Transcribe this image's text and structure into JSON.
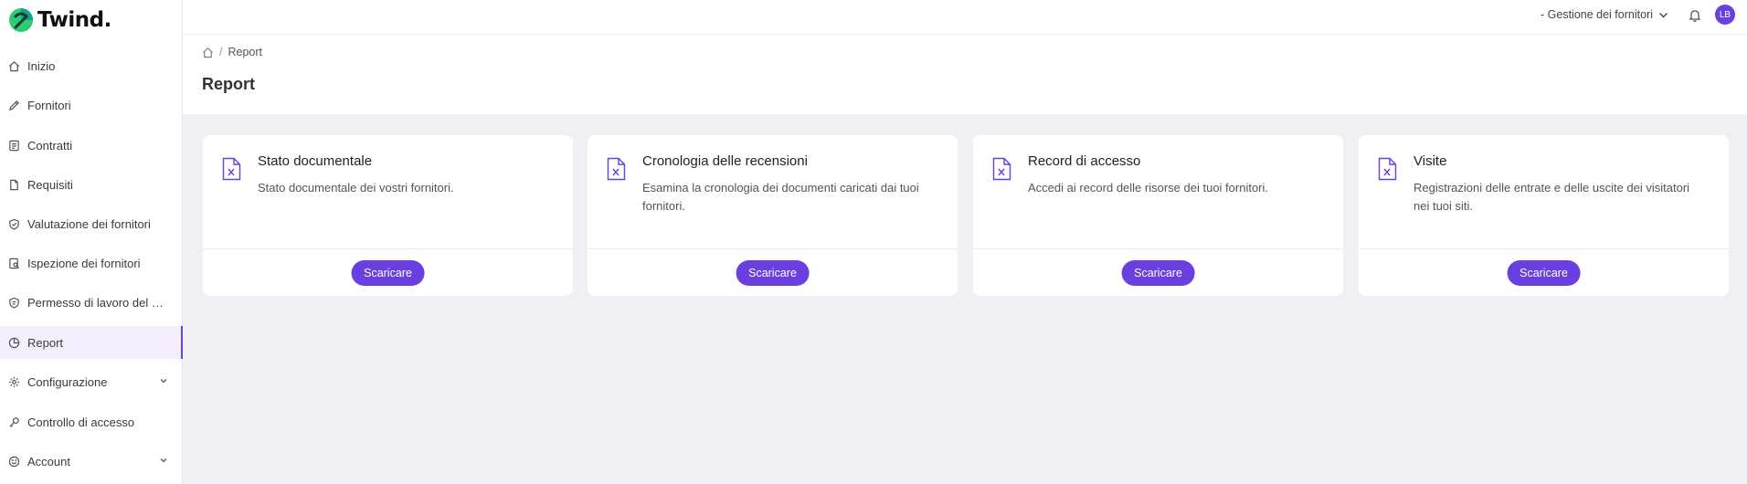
{
  "app": {
    "logo_text": "Twind."
  },
  "sidebar": {
    "items": [
      {
        "label": "Inizio",
        "icon": "home-icon"
      },
      {
        "label": "Fornitori",
        "icon": "pen-icon"
      },
      {
        "label": "Contratti",
        "icon": "contract-icon"
      },
      {
        "label": "Requisiti",
        "icon": "document-icon"
      },
      {
        "label": "Valutazione dei fornitori",
        "icon": "shield-check-icon"
      },
      {
        "label": "Ispezione dei fornitori",
        "icon": "inspection-icon"
      },
      {
        "label": "Permesso di lavoro del fornitore",
        "icon": "permit-shield-icon"
      },
      {
        "label": "Report",
        "icon": "chart-pie-icon",
        "active": true
      },
      {
        "label": "Configurazione",
        "icon": "gear-icon",
        "expandable": true
      },
      {
        "label": "Controllo di accesso",
        "icon": "key-icon"
      },
      {
        "label": "Account",
        "icon": "smile-icon",
        "expandable": true
      }
    ]
  },
  "topbar": {
    "org_selector": "- Gestione dei fornitori",
    "avatar_initials": "LB"
  },
  "header": {
    "breadcrumb_current": "Report",
    "title": "Report"
  },
  "cards": [
    {
      "title": "Stato documentale",
      "description": "Stato documentale dei vostri fornitori.",
      "button": "Scaricare"
    },
    {
      "title": "Cronologia delle recensioni",
      "description": "Esamina la cronologia dei documenti caricati dai tuoi fornitori.",
      "button": "Scaricare"
    },
    {
      "title": "Record di accesso",
      "description": "Accedi ai record delle risorse dei tuoi fornitori.",
      "button": "Scaricare"
    },
    {
      "title": "Visite",
      "description": "Registrazioni delle entrate e delle uscite dei visitatori nei tuoi siti.",
      "button": "Scaricare"
    }
  ],
  "colors": {
    "accent": "#6a3fe0",
    "logo_green": "#2ecc71",
    "background": "#f0f0f4"
  }
}
